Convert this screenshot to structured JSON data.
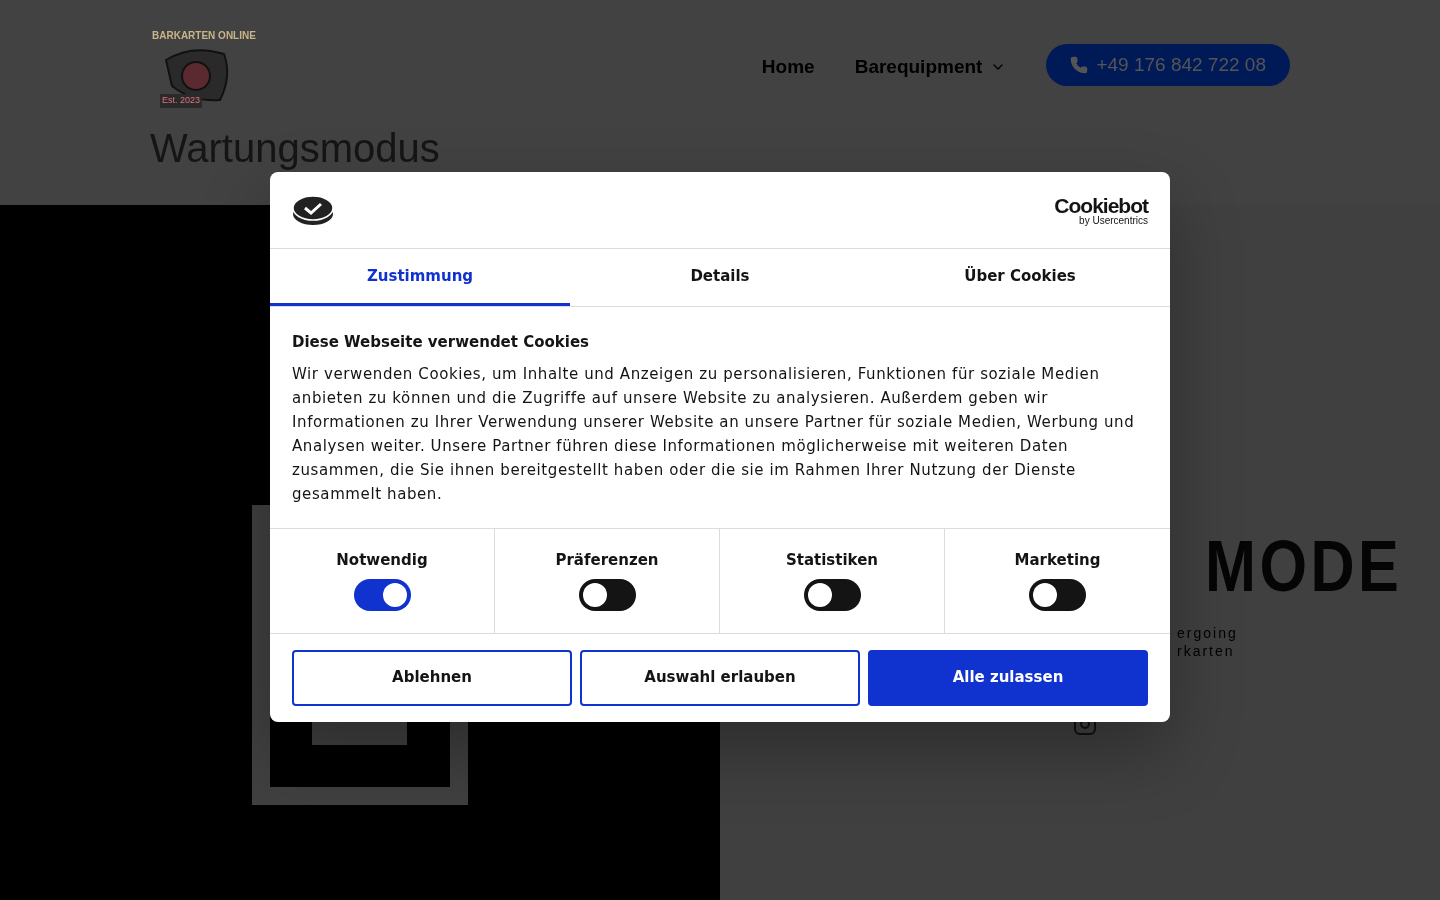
{
  "header": {
    "logo": {
      "title": "BARKARTEN ONLINE",
      "est": "Est. 2023"
    },
    "nav": [
      {
        "label": "Home",
        "kind": "link"
      },
      {
        "label": "Barequipment",
        "kind": "dropdown"
      }
    ],
    "phone_button": "+49 176 842 722 08"
  },
  "page_title": "Wartungsmodus",
  "hero": {
    "headline": "MODE",
    "lines": [
      "ergoing",
      "rkarten"
    ]
  },
  "cookie_dialog": {
    "brand": {
      "name": "Cookiebot",
      "sub": "by Usercentrics"
    },
    "tabs": [
      {
        "label": "Zustimmung",
        "selected": true
      },
      {
        "label": "Details",
        "selected": false
      },
      {
        "label": "Über Cookies",
        "selected": false
      }
    ],
    "heading": "Diese Webseite verwendet Cookies",
    "text": "Wir verwenden Cookies, um Inhalte und Anzeigen zu personalisieren, Funktionen für soziale Medien anbieten zu können und die Zugriffe auf unsere Website zu analysieren. Außerdem geben wir Informationen zu Ihrer Verwendung unserer Website an unsere Partner für soziale Medien, Werbung und Analysen weiter. Unsere Partner führen diese Informationen möglicherweise mit weiteren Daten zusammen, die Sie ihnen bereitgestellt haben oder die sie im Rahmen Ihrer Nutzung der Dienste gesammelt haben.",
    "categories": [
      {
        "label": "Notwendig",
        "on": true
      },
      {
        "label": "Präferenzen",
        "on": false
      },
      {
        "label": "Statistiken",
        "on": false
      },
      {
        "label": "Marketing",
        "on": false
      }
    ],
    "buttons": [
      {
        "label": "Ablehnen",
        "kind": "outline"
      },
      {
        "label": "Auswahl erlauben",
        "kind": "outline"
      },
      {
        "label": "Alle zulassen",
        "kind": "primary"
      }
    ]
  }
}
